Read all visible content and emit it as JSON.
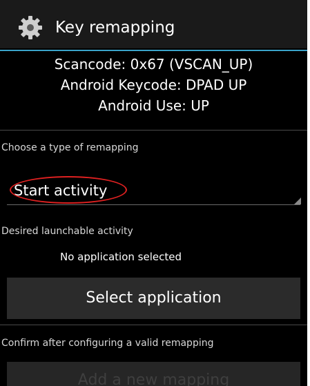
{
  "action_bar": {
    "icon": "gear-icon",
    "title": "Key remapping"
  },
  "key_info": {
    "scancode": "Scancode: 0x67 (VSCAN_UP)",
    "android_keycode": "Android Keycode: DPAD UP",
    "android_use": "Android Use: UP"
  },
  "remap_type": {
    "label": "Choose a type of remapping",
    "selected": "Start activity"
  },
  "activity": {
    "label": "Desired launchable activity",
    "value": "No application selected",
    "button_label": "Select application"
  },
  "confirm": {
    "label": "Confirm after configuring a valid remapping",
    "button_label": "Add a new mapping"
  },
  "colors": {
    "accent_line": "#3aa3c9",
    "highlight_circle": "#e02121",
    "background": "#000000"
  }
}
